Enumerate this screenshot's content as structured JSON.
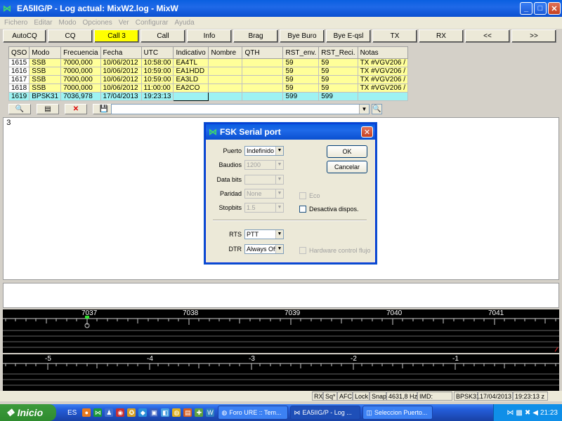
{
  "window": {
    "title": "EA5IIG/P - Log actual: MixW2.log - MixW",
    "icon": "mixw-icon"
  },
  "menu": [
    "Fichero",
    "Editar",
    "Modo",
    "Opciones",
    "Ver",
    "Configurar",
    "Ayuda"
  ],
  "toolbar_buttons": [
    {
      "label": "AutoCQ",
      "highlight": false
    },
    {
      "label": "CQ",
      "highlight": false
    },
    {
      "label": "Call 3",
      "highlight": true
    },
    {
      "label": "Call",
      "highlight": false
    },
    {
      "label": "Info",
      "highlight": false
    },
    {
      "label": "Brag",
      "highlight": false
    },
    {
      "label": "Bye Buro",
      "highlight": false
    },
    {
      "label": "Bye E-qsl",
      "highlight": false
    },
    {
      "label": "TX",
      "highlight": false
    },
    {
      "label": "RX",
      "highlight": false
    },
    {
      "label": "<<",
      "highlight": false
    },
    {
      "label": ">>",
      "highlight": false
    }
  ],
  "log": {
    "columns": [
      "QSO",
      "Modo",
      "Frecuencia",
      "Fecha",
      "UTC",
      "Indicativo",
      "Nombre",
      "QTH",
      "RST_env.",
      "RST_Reci.",
      "Notas"
    ],
    "rows": [
      [
        "1615",
        "SSB",
        "7000,000",
        "10/06/2012",
        "10:58:00",
        "EA4TL",
        "",
        "",
        "59",
        "59",
        "TX #VGV206 /"
      ],
      [
        "1616",
        "SSB",
        "7000,000",
        "10/06/2012",
        "10:59:00",
        "EA1HDD",
        "",
        "",
        "59",
        "59",
        "TX #VGV206 /"
      ],
      [
        "1617",
        "SSB",
        "7000,000",
        "10/06/2012",
        "10:59:00",
        "EA3LD",
        "",
        "",
        "59",
        "59",
        "TX #VGV206 /"
      ],
      [
        "1618",
        "SSB",
        "7000,000",
        "10/06/2012",
        "11:00:00",
        "EA2CO",
        "",
        "",
        "59",
        "59",
        "TX #VGV206 /"
      ],
      [
        "1619",
        "BPSK31",
        "7036,978",
        "17/04/2013",
        "19:23:13",
        "",
        "",
        "",
        "599",
        "599",
        ""
      ]
    ]
  },
  "rx_text": "3",
  "scale_top": [
    "7037",
    "7038",
    "7039",
    "7040",
    "7041"
  ],
  "scale_bottom": [
    "-5",
    "-4",
    "-3",
    "-2",
    "-1"
  ],
  "dialog": {
    "title": "FSK Serial port",
    "fields": [
      {
        "label": "Puerto",
        "value": "Indefinido",
        "disabled": false
      },
      {
        "label": "Baudios",
        "value": "1200",
        "disabled": true
      },
      {
        "label": "Data bits",
        "value": "",
        "disabled": true
      },
      {
        "label": "Paridad",
        "value": "None",
        "disabled": true
      },
      {
        "label": "Stopbits",
        "value": "1.5",
        "disabled": true
      },
      {
        "label": "RTS",
        "value": "PTT",
        "disabled": false
      },
      {
        "label": "DTR",
        "value": "Always Off",
        "disabled": false
      }
    ],
    "ok": "OK",
    "cancel": "Cancelar",
    "checks": [
      {
        "label": "Eco",
        "disabled": true
      },
      {
        "label": "Desactiva dispos.",
        "disabled": false
      },
      {
        "label": "Hardware control flujo",
        "disabled": true
      }
    ]
  },
  "status": {
    "rx": "RX",
    "sq": "Sq*",
    "afc": "AFC",
    "lock": "Lock",
    "snap": "Snap",
    "freq": "4631,8 Hz",
    "imd": "IMD:",
    "mode": "BPSK31",
    "date": "17/04/2013",
    "time": "19:23:13 z"
  },
  "taskbar": {
    "start": "Inicio",
    "lang": "ES",
    "tasks": [
      {
        "label": "Foro URE :: Tem...",
        "active": false
      },
      {
        "label": "EA5IIG/P - Log ...",
        "active": true
      },
      {
        "label": "Seleccion Puerto...",
        "active": false
      }
    ],
    "clock": "21:23"
  }
}
